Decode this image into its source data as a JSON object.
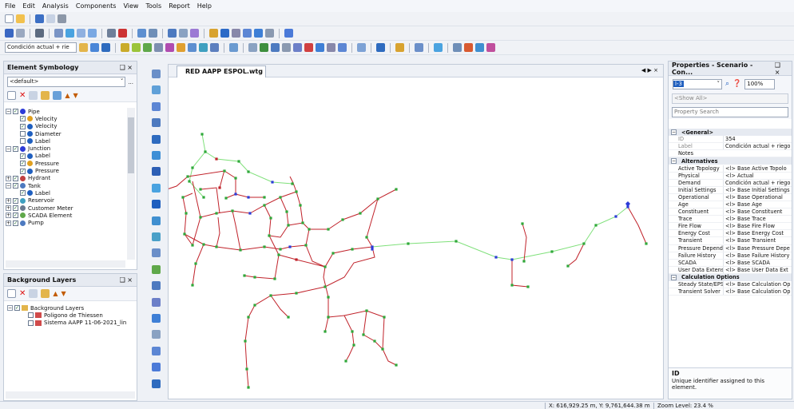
{
  "menu": [
    "File",
    "Edit",
    "Analysis",
    "Components",
    "View",
    "Tools",
    "Report",
    "Help"
  ],
  "toolbar": {
    "scenario_combo": "Condición actual + rie"
  },
  "element_symbology": {
    "title": "Element Symbology",
    "pin": "❑ ×",
    "combo": "<default>",
    "tree": [
      {
        "lvl": 0,
        "pm": "−",
        "cb": true,
        "icon": "pipe",
        "label": "Pipe"
      },
      {
        "lvl": 1,
        "cb": true,
        "icon": "color",
        "label": "Velocity"
      },
      {
        "lvl": 1,
        "cb": true,
        "icon": "font",
        "label": "Velocity"
      },
      {
        "lvl": 1,
        "cb": false,
        "icon": "font",
        "label": "Diameter"
      },
      {
        "lvl": 1,
        "cb": false,
        "icon": "font",
        "label": "Label"
      },
      {
        "lvl": 0,
        "pm": "−",
        "cb": true,
        "icon": "junction",
        "label": "Junction"
      },
      {
        "lvl": 1,
        "cb": true,
        "icon": "font",
        "label": "Label"
      },
      {
        "lvl": 1,
        "cb": true,
        "icon": "color",
        "label": "Pressure"
      },
      {
        "lvl": 1,
        "cb": true,
        "icon": "font",
        "label": "Pressure"
      },
      {
        "lvl": 0,
        "pm": "+",
        "cb": true,
        "icon": "hydrant",
        "label": "Hydrant"
      },
      {
        "lvl": 0,
        "pm": "−",
        "cb": true,
        "icon": "tank",
        "label": "Tank"
      },
      {
        "lvl": 1,
        "cb": true,
        "icon": "font",
        "label": "Label"
      },
      {
        "lvl": 0,
        "pm": "+",
        "cb": true,
        "icon": "reservoir",
        "label": "Reservoir"
      },
      {
        "lvl": 0,
        "pm": "+",
        "cb": true,
        "icon": "meter",
        "label": "Customer Meter"
      },
      {
        "lvl": 0,
        "pm": "+",
        "cb": true,
        "icon": "scada",
        "label": "SCADA Element"
      },
      {
        "lvl": 0,
        "pm": "+",
        "cb": true,
        "icon": "pump",
        "label": "Pump"
      }
    ]
  },
  "background_layers": {
    "title": "Background Layers",
    "pin": "❑ ×",
    "tree": [
      {
        "lvl": 0,
        "pm": "−",
        "cb": true,
        "label": "Background Layers"
      },
      {
        "lvl": 1,
        "cb": false,
        "label": "Poligono de Thiessen"
      },
      {
        "lvl": 1,
        "cb": false,
        "label": "Sistema AAPP 11-06-2021_lin"
      }
    ]
  },
  "drawing": {
    "tab": "RED AAPP ESPOL.wtg",
    "nav": "◀ ▶ ×"
  },
  "properties": {
    "title": "Properties - Scenario - Con...",
    "pin": "❑ ×",
    "id_combo": "l-3",
    "zoom": "100%",
    "show_all": "<Show All>",
    "search": "Property Search",
    "rows": [
      {
        "cat": "<General>"
      },
      {
        "k": "ID",
        "v": "354",
        "grey": true
      },
      {
        "k": "Label",
        "v": "Condición actual + riego",
        "grey": true
      },
      {
        "k": "Notes",
        "v": ""
      },
      {
        "cat": "Alternatives"
      },
      {
        "k": "Active Topology",
        "v": "<l> Base Active Topolo"
      },
      {
        "k": "Physical",
        "v": "<l> Actual"
      },
      {
        "k": "Demand",
        "v": "Condición actual + riego"
      },
      {
        "k": "Initial Settings",
        "v": "<l> Base Initial Settings"
      },
      {
        "k": "Operational",
        "v": "<l> Base Operational"
      },
      {
        "k": "Age",
        "v": "<l> Base Age"
      },
      {
        "k": "Constituent",
        "v": "<l> Base Constituent"
      },
      {
        "k": "Trace",
        "v": "<l> Base Trace"
      },
      {
        "k": "Fire Flow",
        "v": "<l> Base Fire Flow"
      },
      {
        "k": "Energy Cost",
        "v": "<l> Base Energy Cost"
      },
      {
        "k": "Transient",
        "v": "<l> Base Transient"
      },
      {
        "k": "Pressure Depend",
        "v": "<l> Base Pressure Depe"
      },
      {
        "k": "Failure History",
        "v": "<l> Base Failure History"
      },
      {
        "k": "SCADA",
        "v": "<l> Base SCADA"
      },
      {
        "k": "User Data Extens",
        "v": "<l> Base User Data Ext"
      },
      {
        "cat": "Calculation Options"
      },
      {
        "k": "Steady State/EPS",
        "v": "<l> Base Calculation Op"
      },
      {
        "k": "Transient Solver",
        "v": "<l> Base Calculation Op"
      }
    ],
    "desc_title": "ID",
    "desc_text": "Unique identifier assigned to this element."
  },
  "status": {
    "coords": "X: 616,929.25 m, Y: 9,761,644.38 m",
    "zoom": "Zoom Level: 23.4 %"
  },
  "colors": {
    "pipe_red": "#c0222a",
    "pipe_green": "#7fe07a",
    "node_green": "#2fa83a",
    "node_blue": "#2c3bd8",
    "accent": "#1f5fbf"
  }
}
